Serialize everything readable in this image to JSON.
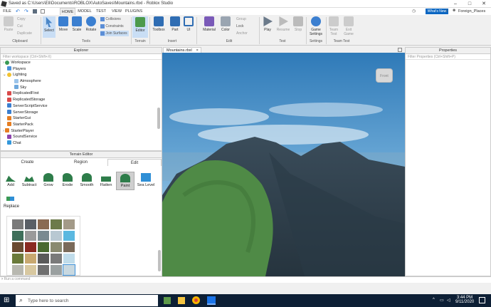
{
  "window": {
    "title": "Saved as C:\\Users\\Eli\\Documents\\ROBLOX\\AutoSaves\\Mountains.rbxl - Roblox Studio"
  },
  "menu": {
    "file": "FILE",
    "tabs": [
      "HOME",
      "MODEL",
      "TEST",
      "VIEW",
      "PLUGINS"
    ],
    "whats_new": "What's New",
    "user": "Foreign_Places"
  },
  "ribbon": {
    "clipboard": {
      "paste": "Paste",
      "copy": "Copy",
      "cut": "Cut",
      "duplicate": "Duplicate",
      "label": "Clipboard"
    },
    "tools": {
      "select": "Select",
      "move": "Move",
      "scale": "Scale",
      "rotate": "Rotate",
      "collisions": "Collisions",
      "constraints": "Constraints",
      "join_surfaces": "Join Surfaces",
      "label": "Tools"
    },
    "terrain": {
      "editor": "Editor",
      "label": "Terrain"
    },
    "insert": {
      "toolbox": "Toolbox",
      "part": "Part",
      "ui": "UI",
      "label": "Insert"
    },
    "edit": {
      "material": "Material",
      "color": "Color",
      "group": "Group",
      "lock": "Lock",
      "anchor": "Anchor",
      "label": "Edit"
    },
    "test": {
      "play": "Play",
      "resume": "Resume",
      "stop": "Stop",
      "label": "Test"
    },
    "settings": {
      "game_settings": "Game Settings",
      "label": "Settings"
    },
    "team_test": {
      "team_test": "Team Test",
      "exit_game": "Exit Game",
      "label": "Team Test"
    }
  },
  "explorer": {
    "title": "Explorer",
    "filter_placeholder": "Filter workspace (Ctrl+Shift+X)",
    "items": [
      "Workspace",
      "Players",
      "Lighting",
      "Atmosphere",
      "Sky",
      "ReplicatedFirst",
      "ReplicatedStorage",
      "ServerScriptService",
      "ServerStorage",
      "StarterGui",
      "StarterPack",
      "StarterPlayer",
      "SoundService",
      "Chat"
    ]
  },
  "terrain_editor": {
    "title": "Terrain Editor",
    "tabs": [
      "Create",
      "Region",
      "Edit"
    ],
    "tools": [
      "Add",
      "Subtract",
      "Grow",
      "Erode",
      "Smooth",
      "Flatten",
      "Paint",
      "Sea Level",
      "Replace"
    ]
  },
  "viewport": {
    "tab": "Mountains.rbxl",
    "view_cube": "Front"
  },
  "properties": {
    "title": "Properties",
    "filter_placeholder": "Filter Properties (Ctrl+Shift+P)"
  },
  "command": {
    "placeholder": "Run a command"
  },
  "taskbar": {
    "search": "Type here to search",
    "time": "3:44 PM",
    "date": "9/11/2020"
  }
}
